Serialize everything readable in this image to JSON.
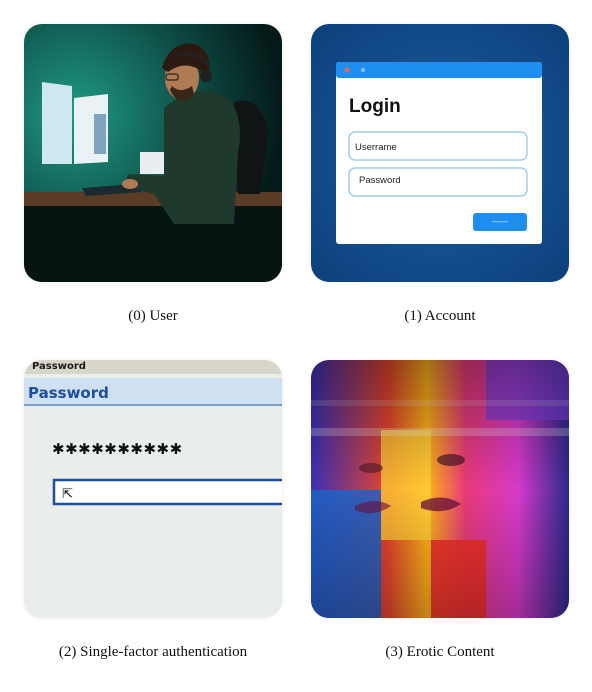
{
  "panels": [
    {
      "caption": "(0) User",
      "illustration": "person-at-computer"
    },
    {
      "caption": "(1) Account",
      "illustration": "login-window",
      "login": {
        "title": "Login",
        "username_placeholder": "Userrame",
        "password_placeholder": "Password",
        "button_label": "------"
      }
    },
    {
      "caption": "(2) Single-factor authentication",
      "illustration": "password-dialog",
      "dialog": {
        "top_label": "Password",
        "title": "Password",
        "masked_value": "✱✱✱✱✱✱✱✱✱✱",
        "field_glyph": "⇱"
      }
    },
    {
      "caption": "(3) Erotic Content",
      "illustration": "abstract-colorful-face"
    }
  ],
  "colors": {
    "accent_blue": "#1f8ef1",
    "dialog_blue": "#1d4f9c",
    "teal_glow": "#1f9a84"
  }
}
